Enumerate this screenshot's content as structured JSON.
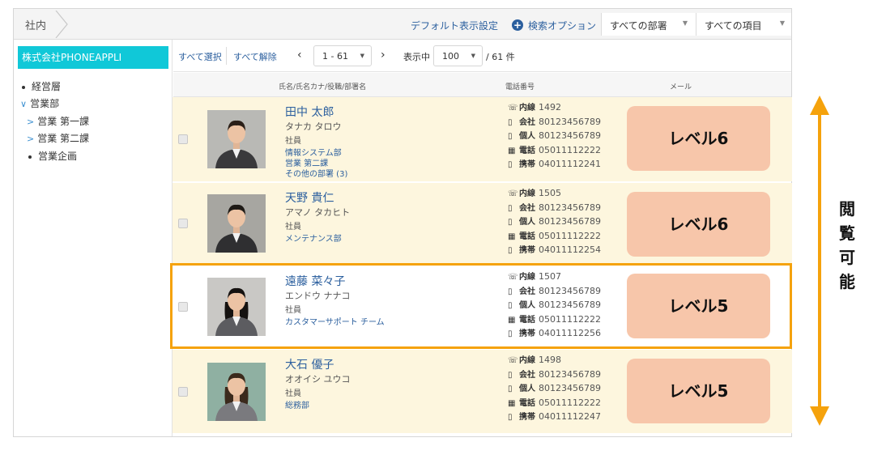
{
  "topbar": {
    "breadcrumb": "社内",
    "default_display_settings": "デフォルト表示設定",
    "search_options": "検索オプション",
    "department_filter": "すべての部署",
    "item_filter": "すべての項目"
  },
  "sidebar": {
    "company": "株式会社PHONEAPPLI",
    "items": [
      {
        "label": "経営層"
      },
      {
        "label": "営業部"
      },
      {
        "label": "営業 第一課"
      },
      {
        "label": "営業 第二課"
      },
      {
        "label": "営業企画"
      }
    ]
  },
  "toolbar": {
    "select_all": "すべて選択",
    "deselect_all": "すべて解除",
    "range": "1 - 61",
    "showing": "表示中",
    "per_page": "100",
    "total": "/ 61 件"
  },
  "columns": {
    "name": "氏名/氏名カナ/役職/部署名",
    "phone": "電話番号",
    "mail": "メール"
  },
  "phone_labels": {
    "ext": "内線",
    "company": "会社",
    "personal": "個人",
    "tel": "電話",
    "mobile": "携帯"
  },
  "rows": [
    {
      "name": "田中 太郎",
      "kana": "タナカ タロウ",
      "title": "社員",
      "depts": [
        "情報システム部",
        "営業 第二課",
        "その他の部署 (3)"
      ],
      "ext": "1492",
      "company": "80123456789",
      "personal": "80123456789",
      "tel": "05011112222",
      "mobile": "04011112241",
      "level": "レベル6"
    },
    {
      "name": "天野 貴仁",
      "kana": "アマノ タカヒト",
      "title": "社員",
      "depts": [
        "メンテナンス部"
      ],
      "ext": "1505",
      "company": "80123456789",
      "personal": "80123456789",
      "tel": "05011112222",
      "mobile": "04011112254",
      "level": "レベル6"
    },
    {
      "name": "遠藤 菜々子",
      "kana": "エンドウ ナナコ",
      "title": "社員",
      "depts": [
        "カスタマーサポート チーム"
      ],
      "ext": "1507",
      "company": "80123456789",
      "personal": "80123456789",
      "tel": "05011112222",
      "mobile": "04011112256",
      "level": "レベル5"
    },
    {
      "name": "大石 優子",
      "kana": "オオイシ ユウコ",
      "title": "社員",
      "depts": [
        "総務部"
      ],
      "ext": "1498",
      "company": "80123456789",
      "personal": "80123456789",
      "tel": "05011112222",
      "mobile": "04011112247",
      "level": "レベル5"
    }
  ],
  "annotation": {
    "label": "閲覧可能",
    "arrow_color": "#f5a20c",
    "highlight_color": "#f5a20c"
  },
  "colors": {
    "accent": "#10c8d8",
    "link": "#2b5f9e",
    "row_bg": "#fdf6de",
    "level_bg": "#f7c6aa"
  }
}
